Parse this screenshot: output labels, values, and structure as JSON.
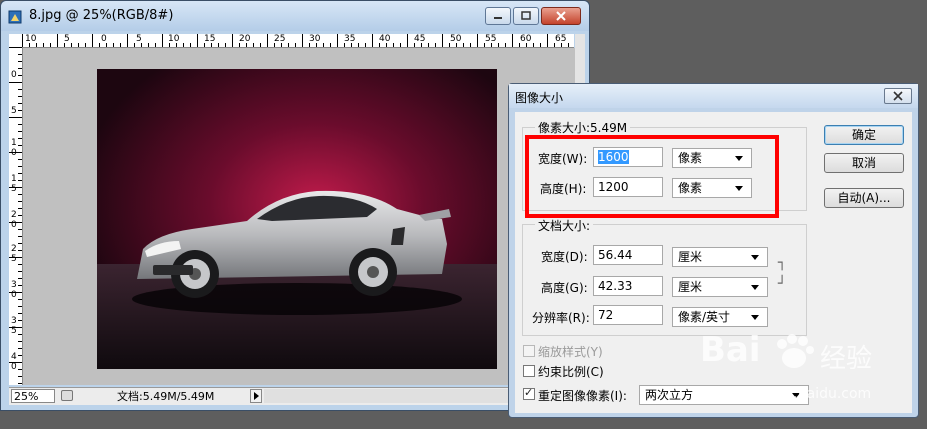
{
  "doc_window": {
    "title": "8.jpg @ 25%(RGB/8#)",
    "ruler_h_labels": [
      "10",
      "5",
      "0",
      "5",
      "10",
      "15",
      "20",
      "25",
      "30",
      "35",
      "40",
      "45",
      "50",
      "55",
      "60",
      "65"
    ],
    "ruler_v_labels": [
      "0",
      "5",
      "1",
      "0",
      "1",
      "5",
      "2",
      "0",
      "2",
      "5",
      "3",
      "0",
      "3",
      "5",
      "4",
      "0"
    ],
    "status": {
      "zoom": "25%",
      "doc_info": "文档:5.49M/5.49M"
    }
  },
  "dialog": {
    "title": "图像大小",
    "pixel_dims": {
      "legend": "像素大小:5.49M",
      "width_label": "宽度(W):",
      "width_value": "1600",
      "width_unit": "像素",
      "height_label": "高度(H):",
      "height_value": "1200",
      "height_unit": "像素"
    },
    "doc_size": {
      "legend": "文档大小:",
      "width_label": "宽度(D):",
      "width_value": "56.44",
      "width_unit": "厘米",
      "height_label": "高度(G):",
      "height_value": "42.33",
      "height_unit": "厘米",
      "res_label": "分辨率(R):",
      "res_value": "72",
      "res_unit": "像素/英寸"
    },
    "options": {
      "scale_styles": "缩放样式(Y)",
      "constrain": "约束比例(C)",
      "resample": "重定图像像素(I):",
      "resample_method": "两次立方"
    },
    "buttons": {
      "ok": "确定",
      "cancel": "取消",
      "auto": "自动(A)..."
    }
  },
  "watermark": {
    "brand": "Bai",
    "brand_cn": "经验",
    "url": "jingyan.baidu.com"
  },
  "colors": {
    "highlight_box": "#ff0000",
    "selection": "#3399ff"
  }
}
